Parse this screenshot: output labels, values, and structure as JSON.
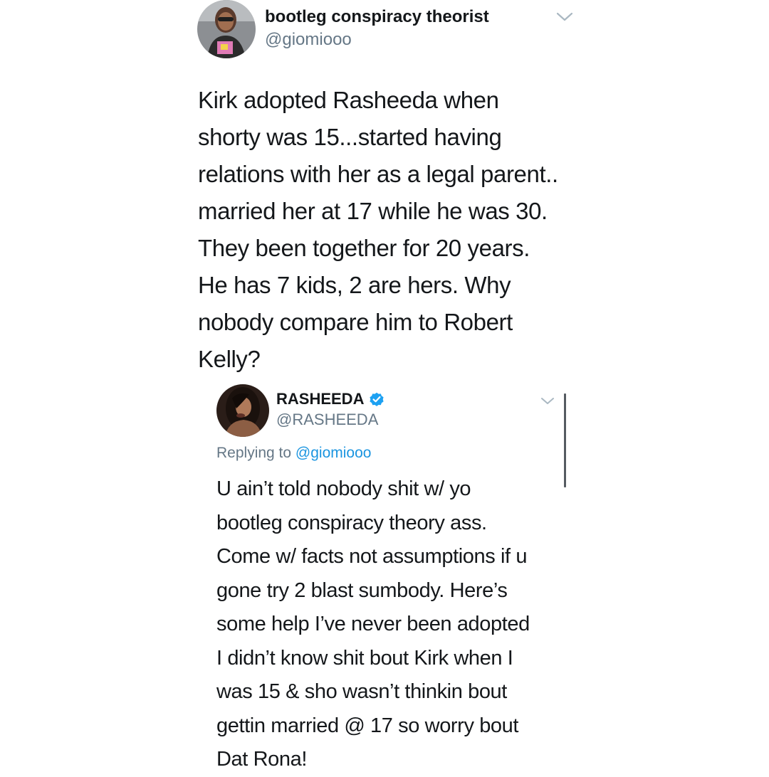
{
  "tweet": {
    "author": {
      "display_name": "bootleg conspiracy theorist",
      "handle": "@giomiooo"
    },
    "menu_icon": "chevron-down-icon",
    "body_lines": [
      "Kirk adopted Rasheeda when",
      "shorty was 15...started having",
      "relations with her as a legal parent..",
      "married her at 17 while he was 30.",
      "They been together for 20 years.",
      "He has 7 kids, 2 are hers. Why",
      "nobody compare him to Robert",
      "Kelly?"
    ]
  },
  "reply": {
    "author": {
      "display_name": "RASHEEDA",
      "handle": "@RASHEEDA",
      "verified": true
    },
    "menu_icon": "chevron-down-icon",
    "replying_prefix": "Replying to",
    "replying_mention": "@giomiooo",
    "body_lines": [
      "U ain’t told nobody shit w/ yo",
      "bootleg conspiracy theory ass.",
      "Come w/ facts not assumptions if u",
      "gone try 2 blast sumbody. Here’s",
      "some help I’ve never been adopted",
      "I didn’t know shit bout Kirk when I",
      "was 15 & sho wasn’t thinkin bout",
      "gettin married @ 17 so worry bout",
      "Dat Rona!"
    ]
  },
  "colors": {
    "text": "#14171a",
    "secondary": "#657786",
    "link": "#1b95e0",
    "verified": "#1da1f2",
    "background": "#ffffff"
  }
}
